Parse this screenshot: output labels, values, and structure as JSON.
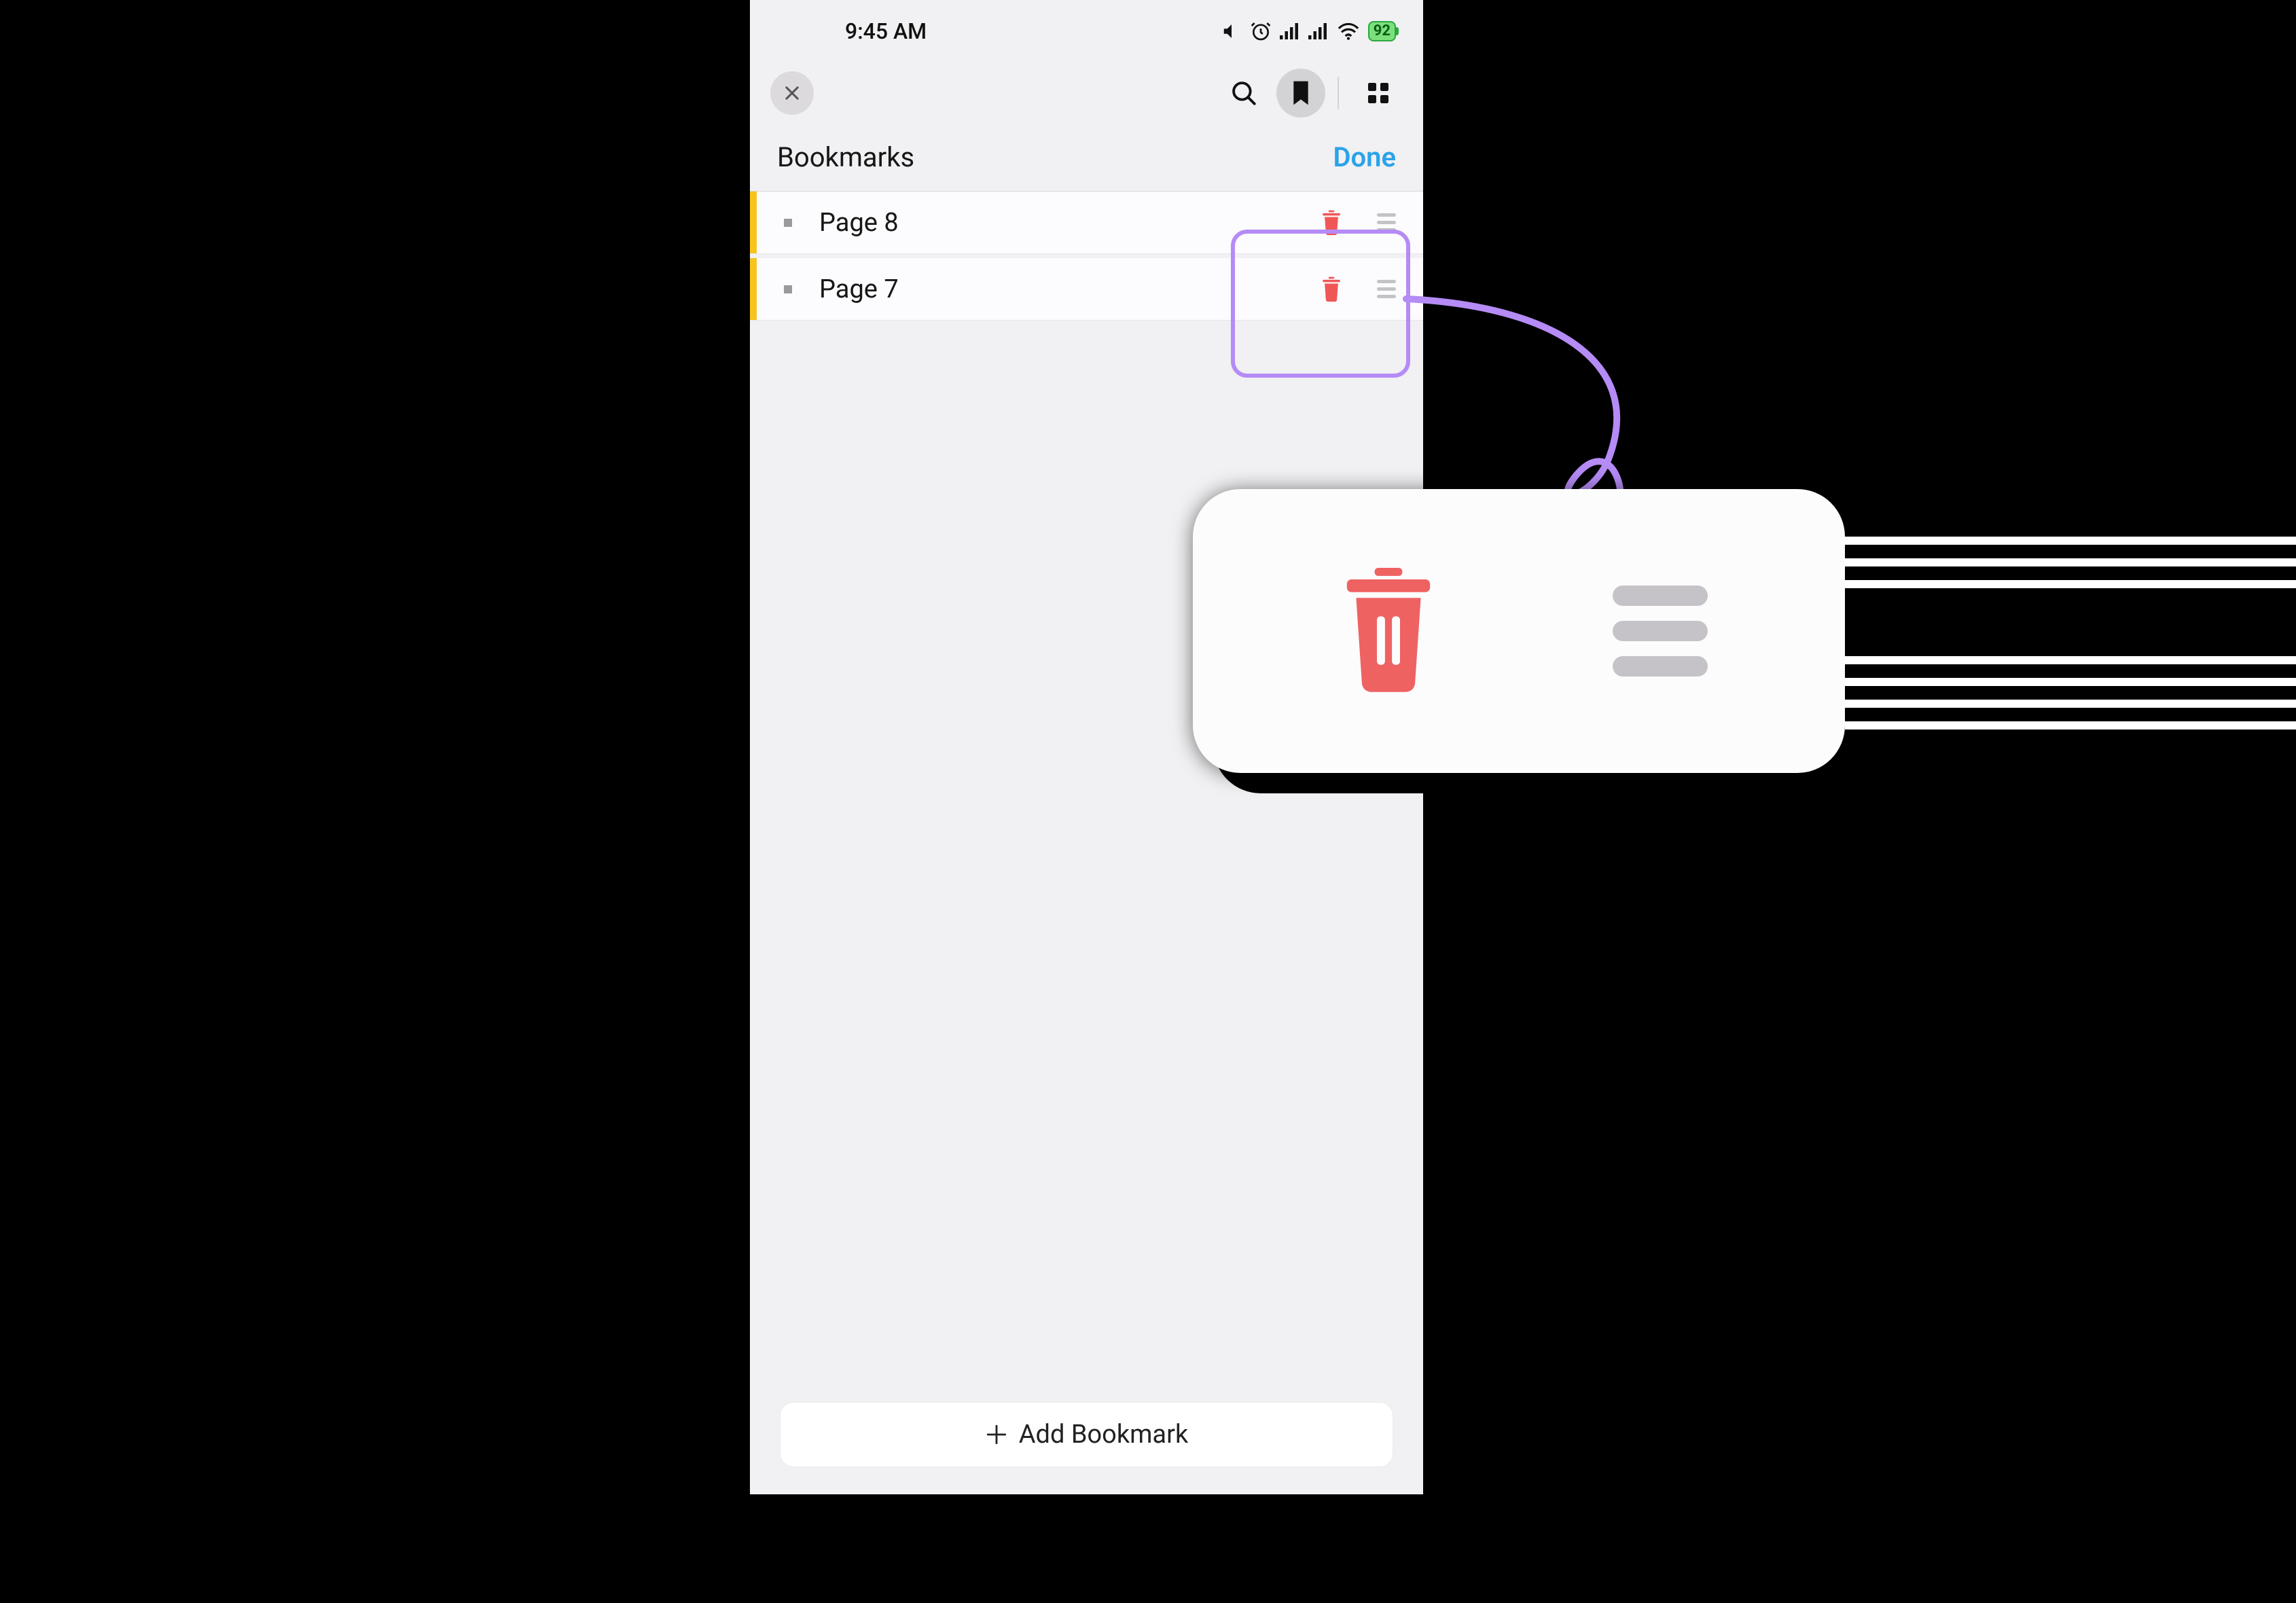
{
  "status": {
    "time": "9:45 AM",
    "battery": "92"
  },
  "section": {
    "title": "Bookmarks",
    "done": "Done"
  },
  "bookmarks": [
    {
      "label": "Page 8"
    },
    {
      "label": "Page 7"
    }
  ],
  "add_button": "Add Bookmark",
  "callout": {
    "delete_icon": "trash-icon",
    "reorder_icon": "reorder-handle-icon"
  },
  "annotation": {
    "highlight_target": "bookmark-row-actions",
    "arrow_color": "#b58bf6"
  }
}
